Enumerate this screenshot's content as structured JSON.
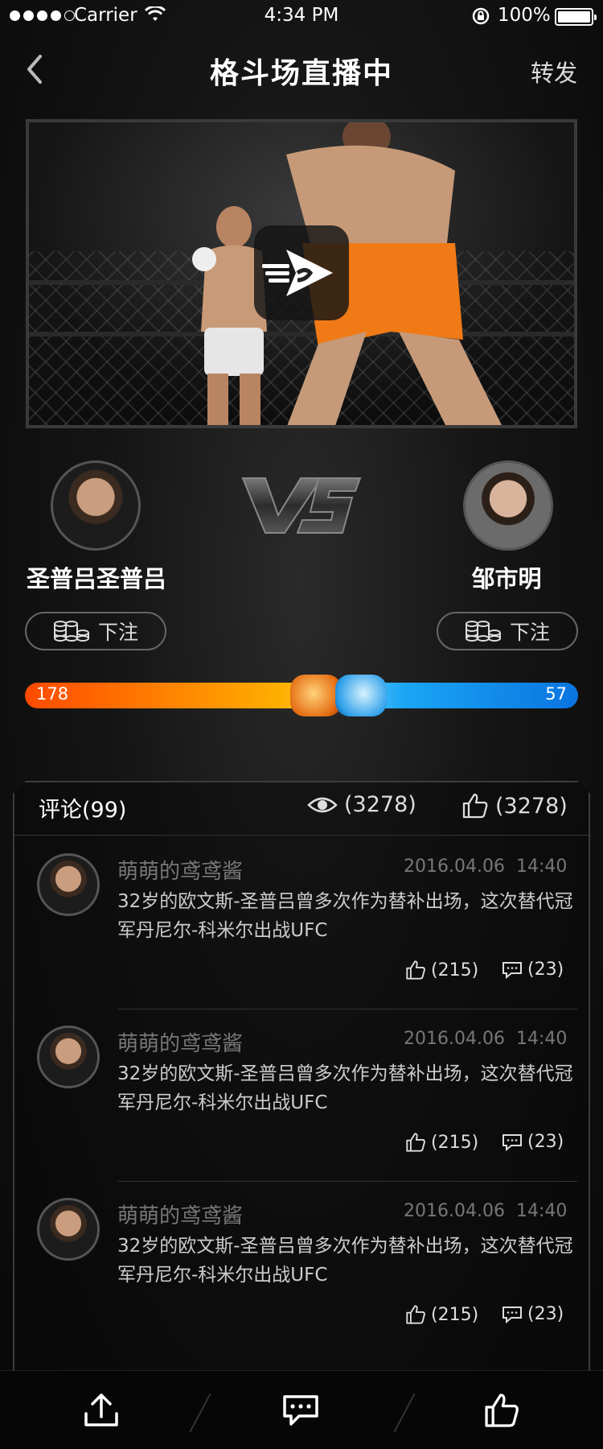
{
  "status_bar": {
    "carrier": "Carrier",
    "time": "4:34 PM",
    "battery": "100%"
  },
  "nav": {
    "title": "格斗场直播中",
    "share": "转发",
    "icons": [
      "back-arrow-icon"
    ]
  },
  "video": {
    "icons": [
      "play-icon"
    ]
  },
  "match": {
    "fighter_left": {
      "name": "圣普吕圣普吕",
      "bet_label": "下注"
    },
    "fighter_right": {
      "name": "邹市明",
      "bet_label": "下注"
    },
    "vs_icon": "vs-icon",
    "score_left": "178",
    "score_right": "57",
    "score_left_value": 178,
    "score_right_value": 57,
    "colors": {
      "left": "#ff6a00",
      "right": "#1a8ff0"
    }
  },
  "comments": {
    "count_label": "评论(99)",
    "views": "(3278)",
    "likes": "(3278)",
    "items": [
      {
        "user": "萌萌的鸢鸢酱",
        "date": "2016.04.06",
        "time": "14:40",
        "text": "32岁的欧文斯-圣普吕曾多次作为替补出场，这次替代冠军丹尼尔-科米尔出战UFC",
        "likes": "(215)",
        "replies": "(23)"
      },
      {
        "user": "萌萌的鸢鸢酱",
        "date": "2016.04.06",
        "time": "14:40",
        "text": "32岁的欧文斯-圣普吕曾多次作为替补出场，这次替代冠军丹尼尔-科米尔出战UFC",
        "likes": "(215)",
        "replies": "(23)"
      },
      {
        "user": "萌萌的鸢鸢酱",
        "date": "2016.04.06",
        "time": "14:40",
        "text": "32岁的欧文斯-圣普吕曾多次作为替补出场，这次替代冠军丹尼尔-科米尔出战UFC",
        "likes": "(215)",
        "replies": "(23)"
      }
    ]
  },
  "bottom_bar": {
    "icons": [
      "upload-icon",
      "comment-icon",
      "thumbs-up-icon"
    ]
  }
}
